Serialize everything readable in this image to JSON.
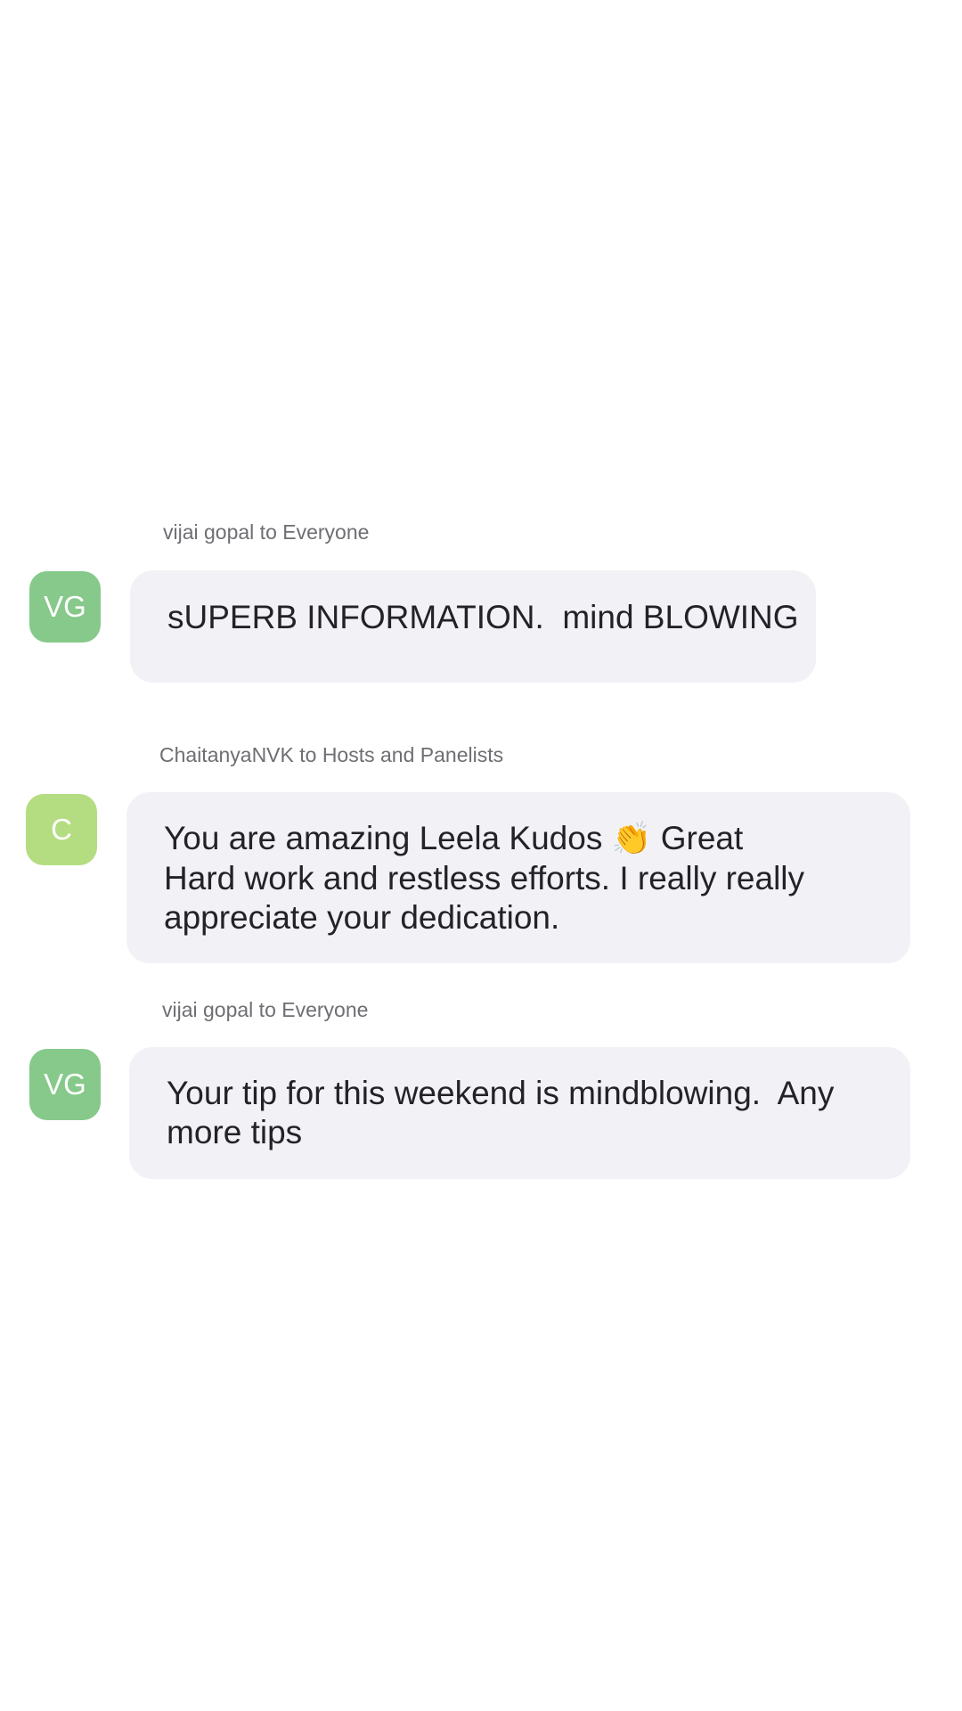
{
  "colors": {
    "avatar_vg": "#86c98a",
    "avatar_c": "#b4dd82",
    "bubble_bg": "#f2f2f6",
    "sender_text": "#6e6e73",
    "message_text": "#222228"
  },
  "messages": [
    {
      "sender": "vijai gopal to Everyone",
      "avatar_initials": "VG",
      "text": "sUPERB INFORMATION.  mind BLOWING"
    },
    {
      "sender": "ChaitanyaNVK to Hosts and Panelists",
      "avatar_initials": "C",
      "text_part1": "You are amazing Leela Kudos ",
      "emoji_icon": "clapping-hands-icon",
      "text_part2": " Great\nHard work and restless efforts. I really really\nappreciate your dedication."
    },
    {
      "sender": "vijai gopal to Everyone",
      "avatar_initials": "VG",
      "text": "Your tip for this weekend is mindblowing.  Any\nmore tips"
    }
  ]
}
